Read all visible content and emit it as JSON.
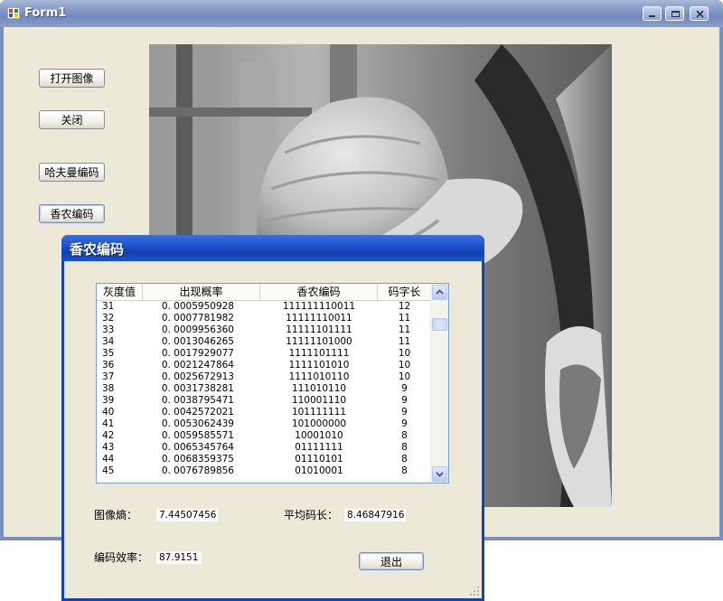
{
  "main_window": {
    "title": "Form1",
    "buttons": {
      "open_image": "打开图像",
      "close": "关闭",
      "huffman": "哈夫曼编码",
      "shannon": "香农编码"
    }
  },
  "dialog": {
    "title": "香农编码",
    "table": {
      "headers": [
        "灰度值",
        "出现概率",
        "香农编码",
        "码字长"
      ],
      "rows": [
        [
          "31",
          "0.0005950928",
          "111111110011",
          "12"
        ],
        [
          "32",
          "0.0007781982",
          "11111110011",
          "11"
        ],
        [
          "33",
          "0.0009956360",
          "11111101111",
          "11"
        ],
        [
          "34",
          "0.0013046265",
          "11111101000",
          "11"
        ],
        [
          "35",
          "0.0017929077",
          "1111101111",
          "10"
        ],
        [
          "36",
          "0.0021247864",
          "1111101010",
          "10"
        ],
        [
          "37",
          "0.0025672913",
          "1111010110",
          "10"
        ],
        [
          "38",
          "0.0031738281",
          "111010110",
          "9"
        ],
        [
          "39",
          "0.0038795471",
          "110001110",
          "9"
        ],
        [
          "40",
          "0.0042572021",
          "101111111",
          "9"
        ],
        [
          "41",
          "0.0053062439",
          "101000000",
          "9"
        ],
        [
          "42",
          "0.0059585571",
          "10001010",
          "8"
        ],
        [
          "43",
          "0.0065345764",
          "01111111",
          "8"
        ],
        [
          "44",
          "0.0068359375",
          "01110101",
          "8"
        ],
        [
          "45",
          "0.0076789856",
          "01010001",
          "8"
        ]
      ]
    },
    "entropy_label": "图像熵：",
    "entropy_value": "7.44507456",
    "avg_len_label": "平均码长：",
    "avg_len_value": "8.46847916",
    "efficiency_label": "编码效率：",
    "efficiency_value": "87.9151",
    "exit_button": "退出"
  }
}
